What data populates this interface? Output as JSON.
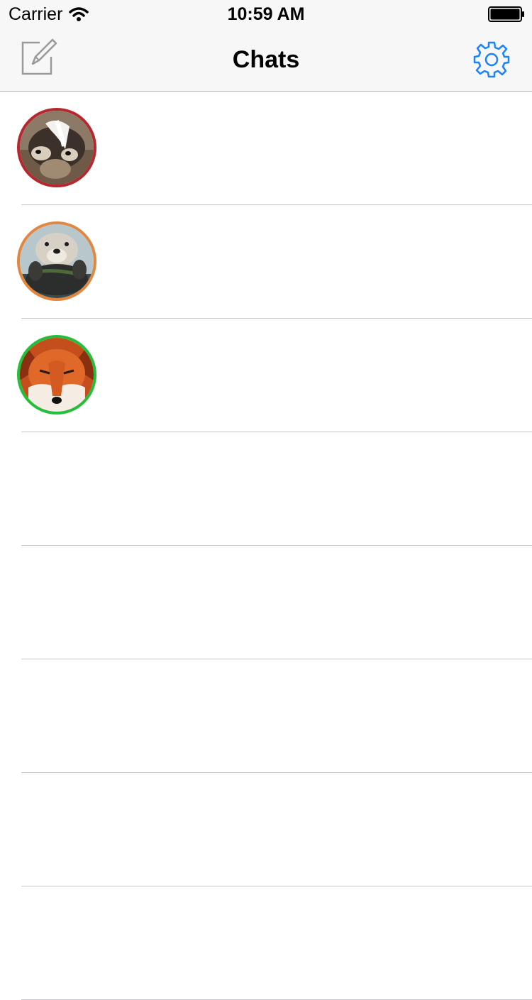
{
  "status_bar": {
    "carrier": "Carrier",
    "time": "10:59 AM"
  },
  "nav": {
    "title": "Chats",
    "left_icon": "compose-icon",
    "right_icon": "gear-icon",
    "accent_color": "#1a82fb"
  },
  "chats": [
    {
      "animal": "badger",
      "ring_color": "#b7272d"
    },
    {
      "animal": "otter",
      "ring_color": "#e2873f"
    },
    {
      "animal": "fox",
      "ring_color": "#22c03a"
    }
  ],
  "empty_rows": 5
}
